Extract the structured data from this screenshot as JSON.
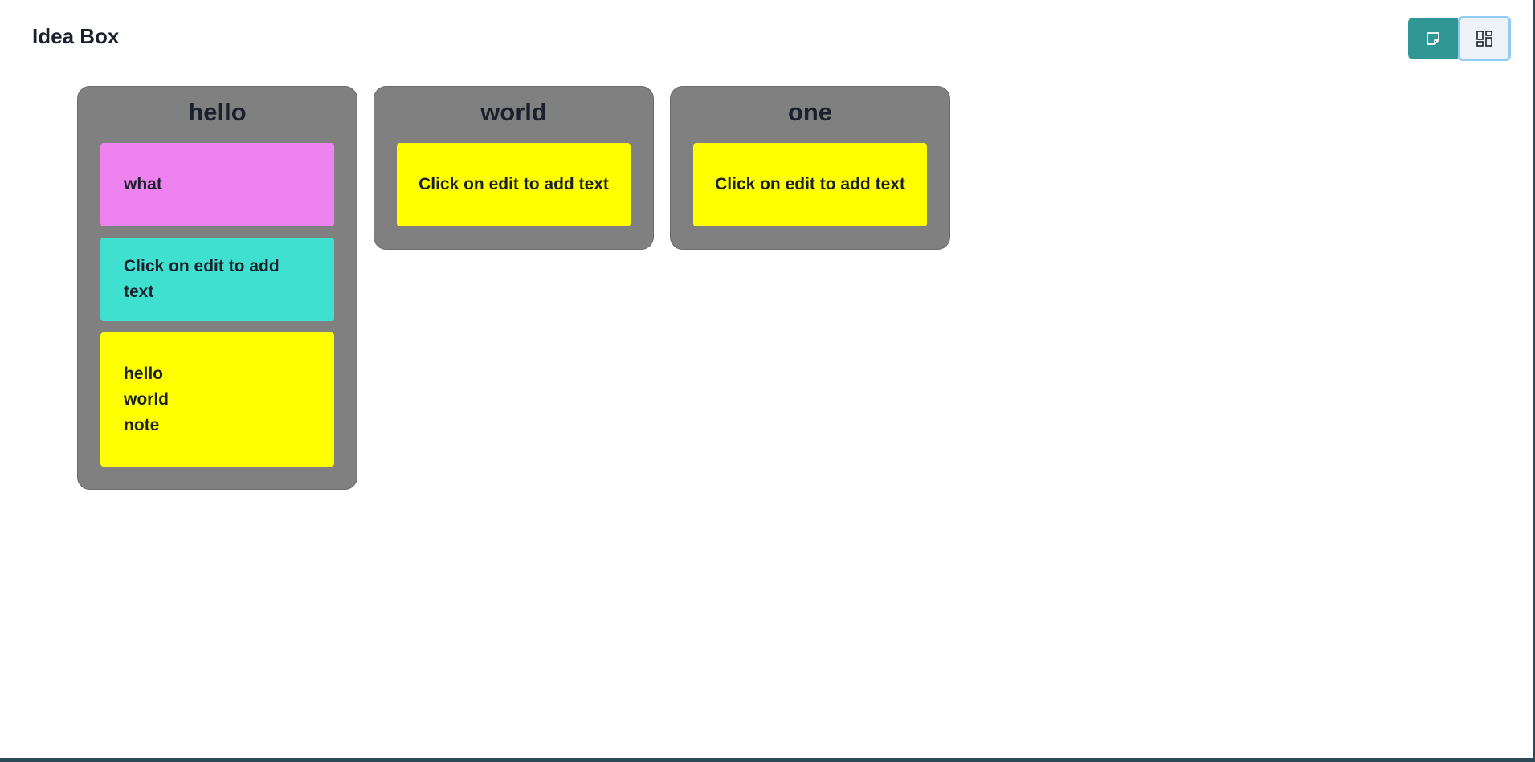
{
  "app": {
    "title": "Idea Box"
  },
  "toolbar": {
    "note_icon": "sticky-note-icon",
    "board_icon": "layout-grid-icon",
    "accent_color": "#319795"
  },
  "boards": [
    {
      "title": "hello",
      "notes": [
        {
          "text": "what",
          "color": "#ee82ee"
        },
        {
          "text": "Click on edit to add text",
          "color": "#40e0d0"
        },
        {
          "text": "hello\nworld\nnote",
          "color": "#ffff00"
        }
      ]
    },
    {
      "title": "world",
      "notes": [
        {
          "text": "Click on edit to add text",
          "color": "#ffff00"
        }
      ]
    },
    {
      "title": "one",
      "notes": [
        {
          "text": "Click on edit to add text",
          "color": "#ffff00"
        }
      ]
    }
  ],
  "colors": {
    "board_bg": "#808080",
    "text": "#1a202c"
  }
}
